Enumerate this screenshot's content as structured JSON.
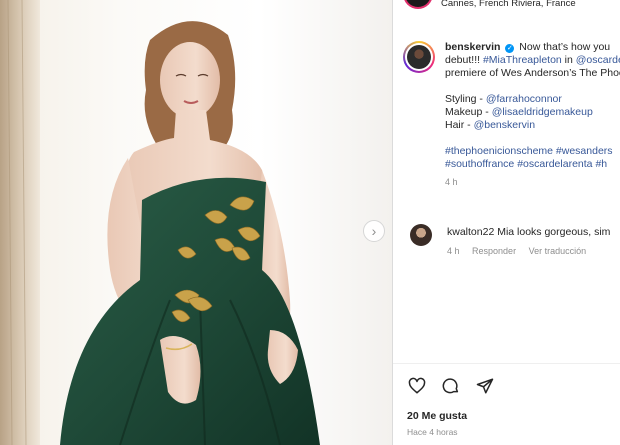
{
  "post": {
    "location": "Cannes, French Riviera, France",
    "author": "benskervin",
    "verified": true,
    "caption_lines": [
      [
        {
          "t": "Now that’s how you "
        }
      ],
      [
        {
          "t": "debut!!! "
        },
        {
          "t": "#MiaThreapleton",
          "link": true
        },
        {
          "t": " in "
        },
        {
          "t": "@oscarde",
          "link": true
        }
      ],
      [
        {
          "t": "premiere of Wes Anderson’s The Phoe"
        }
      ],
      [],
      [
        {
          "t": "Styling - "
        },
        {
          "t": "@farrahoconnor",
          "link": true
        }
      ],
      [
        {
          "t": "Makeup - "
        },
        {
          "t": "@lisaeldridgemakeup",
          "link": true
        }
      ],
      [
        {
          "t": "Hair - "
        },
        {
          "t": "@benskervin",
          "link": true
        }
      ],
      [],
      [
        {
          "t": "#thephoenicionscheme",
          "link": true
        },
        {
          "t": " "
        },
        {
          "t": "#wesanders",
          "link": true
        }
      ],
      [
        {
          "t": "#southoffrance",
          "link": true
        },
        {
          "t": " "
        },
        {
          "t": "#oscardelarenta",
          "link": true
        },
        {
          "t": " "
        },
        {
          "t": "#h",
          "link": true
        }
      ]
    ],
    "caption_time": "4 h"
  },
  "comment": {
    "username": "kwalton22",
    "text": "Mia looks gorgeous, sim",
    "time": "4 h",
    "reply_label": "Responder",
    "translate_label": "Ver traducción"
  },
  "actions": {
    "icons": [
      "heart-icon",
      "comment-icon",
      "share-icon"
    ]
  },
  "likes": "20 Me gusta",
  "posted_ago": "Hace 4 horas",
  "next_icon": "›",
  "colors": {
    "link": "#385898",
    "dress": "#1f4a38",
    "gold": "#c9a24a",
    "muted": "#8e8e8e"
  }
}
